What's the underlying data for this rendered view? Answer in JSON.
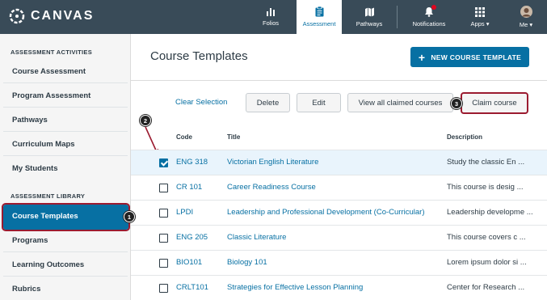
{
  "app": {
    "brand": "CANVAS"
  },
  "nav": [
    {
      "label": "Folios",
      "icon": "bar-chart-icon"
    },
    {
      "label": "Assessment",
      "icon": "clipboard-icon",
      "active": true
    },
    {
      "label": "Pathways",
      "icon": "map-icon"
    },
    {
      "label": "Notifications",
      "icon": "bell-icon"
    },
    {
      "label": "Apps ▾",
      "icon": "grid-icon"
    },
    {
      "label": "Me ▾",
      "icon": "avatar-icon"
    }
  ],
  "sidebar": {
    "heading_activities": "ASSESSMENT ACTIVITIES",
    "activities": [
      "Course Assessment",
      "Program Assessment",
      "Pathways",
      "Curriculum Maps",
      "My Students"
    ],
    "heading_library": "ASSESSMENT LIBRARY",
    "library": [
      "Course Templates",
      "Programs",
      "Learning Outcomes",
      "Rubrics"
    ]
  },
  "main": {
    "title": "Course Templates",
    "new_button": "NEW COURSE TEMPLATE",
    "toolbar": {
      "clear": "Clear Selection",
      "delete": "Delete",
      "edit": "Edit",
      "view_claimed": "View all claimed courses",
      "claim": "Claim course"
    },
    "columns": {
      "code": "Code",
      "title": "Title",
      "description": "Description"
    },
    "rows": [
      {
        "code": "ENG 318",
        "title": "Victorian English Literature",
        "description": "Study the classic En ...",
        "checked": true
      },
      {
        "code": "CR 101",
        "title": "Career Readiness Course",
        "description": "This course is desig ...",
        "checked": false
      },
      {
        "code": "LPDI",
        "title": "Leadership and Professional Development (Co-Curricular)",
        "description": "Leadership developme ...",
        "checked": false
      },
      {
        "code": "ENG 205",
        "title": "Classic Literature",
        "description": "This course covers c ...",
        "checked": false
      },
      {
        "code": "BIO101",
        "title": "Biology 101",
        "description": "Lorem ipsum dolor si ...",
        "checked": false
      },
      {
        "code": "CRLT101",
        "title": "Strategies for Effective Lesson Planning",
        "description": "Center for Research ...",
        "checked": false
      }
    ]
  },
  "callouts": [
    "1",
    "2",
    "3"
  ],
  "colors": {
    "nav_bg": "#394b58",
    "accent": "#0770a3",
    "highlight": "#9b1b30"
  }
}
